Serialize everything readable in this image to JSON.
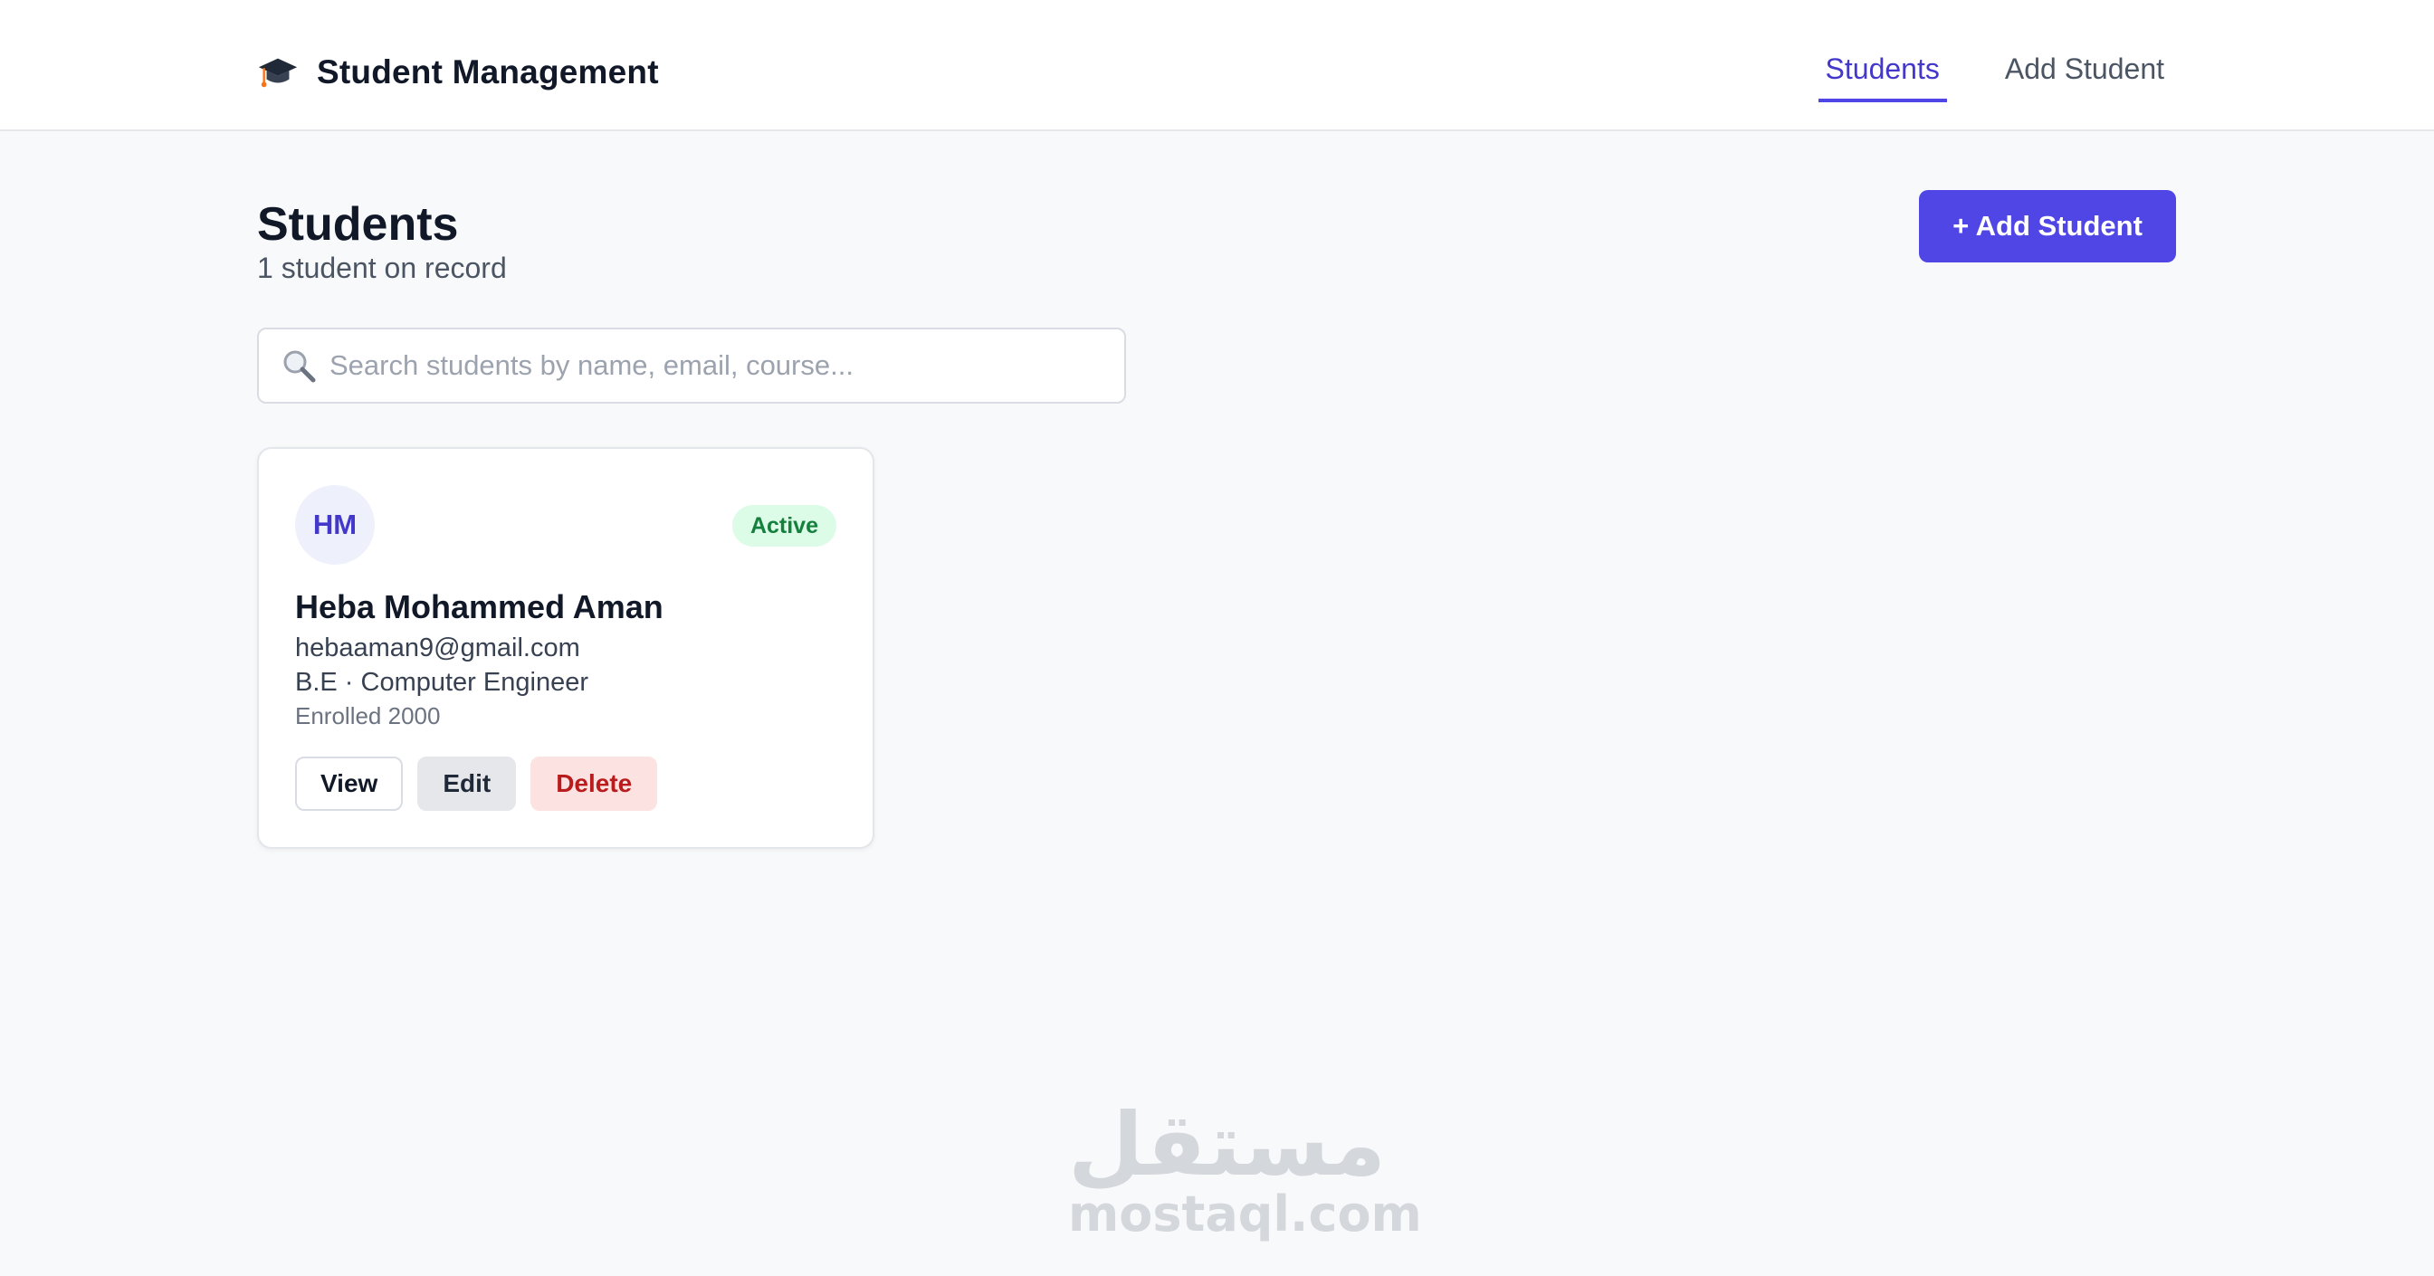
{
  "app": {
    "title": "Student Management",
    "brand_icon": "graduation-cap-icon"
  },
  "nav": {
    "items": [
      {
        "label": "Students",
        "active": true
      },
      {
        "label": "Add Student",
        "active": false
      }
    ]
  },
  "page": {
    "title": "Students",
    "subtitle": "1 student on record",
    "add_button_label": "+ Add Student"
  },
  "search": {
    "placeholder": "Search students by name, email, course...",
    "value": "",
    "icon": "search-icon"
  },
  "students": [
    {
      "initials": "HM",
      "status": "Active",
      "name": "Heba Mohammed Aman",
      "email": "hebaaman9@gmail.com",
      "course": "B.E · Computer Engineer",
      "enrolled": "Enrolled 2000",
      "actions": {
        "view": "View",
        "edit": "Edit",
        "delete": "Delete"
      }
    }
  ],
  "colors": {
    "accent": "#4f46e5",
    "status_active_bg": "#dcfce7",
    "status_active_text": "#15803d",
    "danger_text": "#b91c1c",
    "danger_bg": "#fde2e2"
  },
  "watermark": {
    "arabic": "مستقل",
    "latin": "mostaql.com"
  }
}
